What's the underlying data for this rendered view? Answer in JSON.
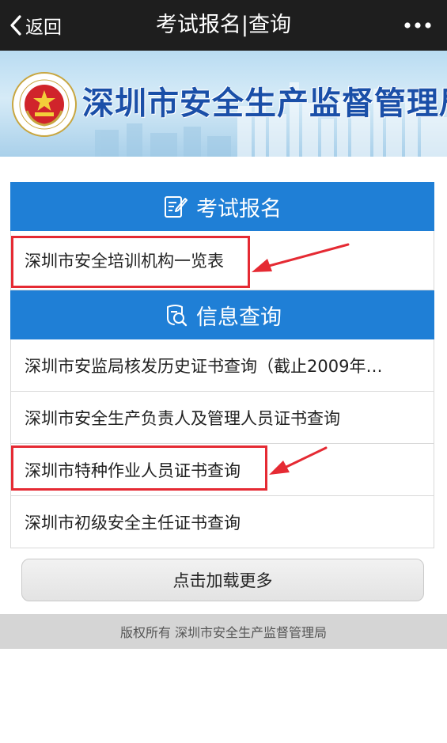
{
  "navbar": {
    "back_label": "返回",
    "title": "考试报名|查询",
    "back_icon": "chevron-left-icon",
    "more_icon": "more-dots-icon"
  },
  "banner": {
    "title": "深圳市安全生产监督管理局",
    "emblem_icon": "national-emblem-icon"
  },
  "sections": [
    {
      "title": "考试报名",
      "icon": "edit-form-icon",
      "items": [
        {
          "label": "深圳市安全培训机构一览表"
        }
      ]
    },
    {
      "title": "信息查询",
      "icon": "info-query-icon",
      "items": [
        {
          "label": "深圳市安监局核发历史证书查询（截止2009年…"
        },
        {
          "label": "深圳市安全生产负责人及管理人员证书查询"
        },
        {
          "label": "深圳市特种作业人员证书查询"
        },
        {
          "label": "深圳市初级安全主任证书查询"
        }
      ]
    }
  ],
  "load_more": {
    "label": "点击加载更多"
  },
  "footer": {
    "text": "版权所有 深圳市安全生产监督管理局"
  },
  "colors": {
    "navbar_bg": "#1e1e1e",
    "section_header_bg": "#1f7fd6",
    "annotation_red": "#e52a33",
    "banner_title": "#1a4fa8",
    "footer_bg": "#d5d5d5"
  }
}
